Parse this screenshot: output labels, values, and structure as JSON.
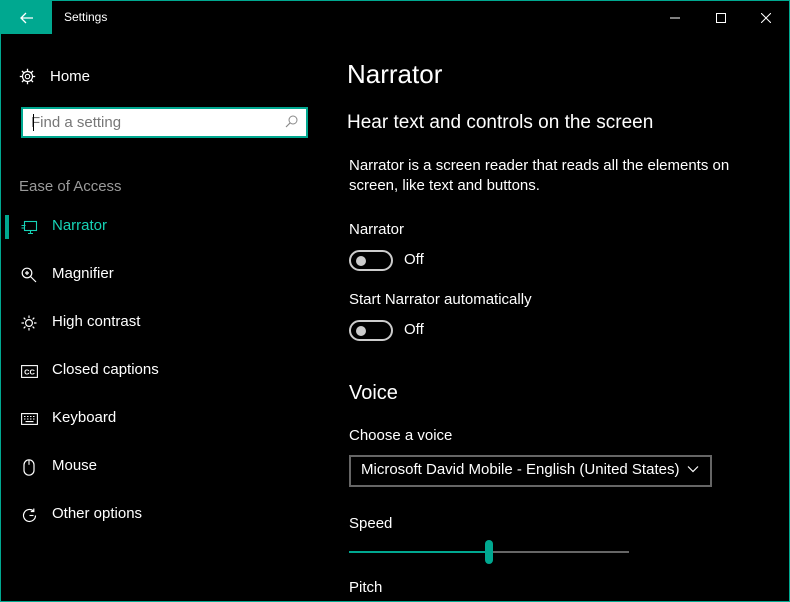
{
  "window": {
    "title": "Settings",
    "accent": "#00a890",
    "background": "#000000"
  },
  "titlebar": {
    "back_icon": "arrow-left-icon",
    "controls": [
      "minimize-icon",
      "maximize-icon",
      "close-icon"
    ]
  },
  "sidebar": {
    "home_label": "Home",
    "home_icon": "gear-icon",
    "search": {
      "placeholder": "Find a setting",
      "value": "",
      "icon": "search-icon"
    },
    "section_label": "Ease of Access",
    "items": [
      {
        "label": "Narrator",
        "icon": "narrator-icon",
        "selected": true
      },
      {
        "label": "Magnifier",
        "icon": "magnifier-icon",
        "selected": false
      },
      {
        "label": "High contrast",
        "icon": "sun-icon",
        "selected": false
      },
      {
        "label": "Closed captions",
        "icon": "cc-icon",
        "selected": false
      },
      {
        "label": "Keyboard",
        "icon": "keyboard-icon",
        "selected": false
      },
      {
        "label": "Mouse",
        "icon": "mouse-icon",
        "selected": false
      },
      {
        "label": "Other options",
        "icon": "refresh-icon",
        "selected": false
      }
    ]
  },
  "main": {
    "title": "Narrator",
    "subtitle": "Hear text and controls on the screen",
    "description": "Narrator is a screen reader that reads all the elements on screen, like text and buttons.",
    "narrator_toggle": {
      "label": "Narrator",
      "state": "Off",
      "on": false
    },
    "auto_toggle": {
      "label": "Start Narrator automatically",
      "state": "Off",
      "on": false
    },
    "voice_section": "Voice",
    "voice_label": "Choose a voice",
    "voice_value": "Microsoft David Mobile - English (United States)",
    "speed_label": "Speed",
    "speed_level": 0.5,
    "pitch_label": "Pitch"
  }
}
